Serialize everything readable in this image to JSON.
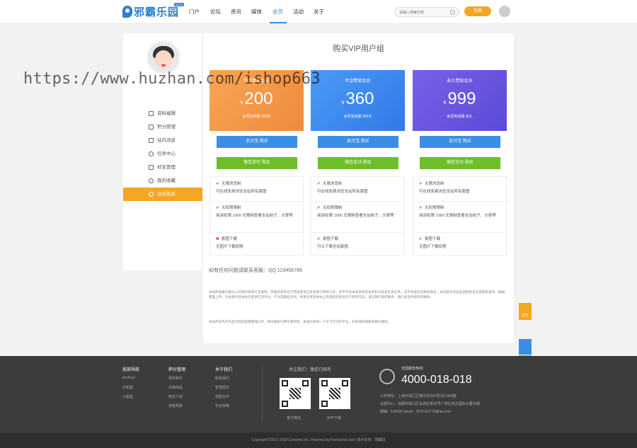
{
  "header": {
    "logo_text": "邪霸乐园",
    "logo_badge": "BETA",
    "nav": [
      "门户",
      "论坛",
      "资讯",
      "媒体",
      "会员",
      "活动",
      "关于"
    ],
    "search_placeholder": "请输入搜索内容",
    "post_button": "投稿"
  },
  "sidebar": {
    "items": [
      {
        "label": "资料编辑",
        "icon": "edit-icon"
      },
      {
        "label": "积分管理",
        "icon": "card-icon"
      },
      {
        "label": "站内消息",
        "icon": "mail-icon"
      },
      {
        "label": "任务中心",
        "icon": "info-icon"
      },
      {
        "label": "好友管理",
        "icon": "friends-icon"
      },
      {
        "label": "我的收藏",
        "icon": "gear-icon"
      },
      {
        "label": "会员购买",
        "icon": "heart-icon"
      }
    ],
    "active_index": 6
  },
  "main": {
    "title": "购买VIP用户组",
    "plans": [
      {
        "name": "包月赞助会员",
        "currency": "¥",
        "price": "200",
        "duration": "会员有效期 185天",
        "color": "#f5a04a"
      },
      {
        "name": "年会赞助会员",
        "currency": "¥",
        "price": "360",
        "duration": "会员有效期 365天",
        "color": "#3f8ef0"
      },
      {
        "name": "永久赞助会员",
        "currency": "¥",
        "price": "999",
        "duration": "会员有效期 永久",
        "color": "#6c57e0"
      }
    ],
    "alipay_button": "支付宝 购买",
    "wechat_button": "微信支付 购买",
    "features": [
      [
        {
          "title": "无限浏览制",
          "desc": "可在线免费浏览全站所有套图",
          "ok": true
        },
        {
          "title": "无权限限制",
          "desc": "阅读权限 1000 无限制查看全站帖子、文章等",
          "ok": true
        },
        {
          "title": "套图下载",
          "desc": "无图片下载权限",
          "ok": false
        }
      ],
      [
        {
          "title": "无限浏览制",
          "desc": "可在线免费浏览全站所有套图",
          "ok": true
        },
        {
          "title": "无权限限制",
          "desc": "阅读权限 1000 无限制查看全站帖子、文章等",
          "ok": true
        },
        {
          "title": "套图下载",
          "desc": "可以下载全站套图",
          "ok": true
        }
      ],
      [
        {
          "title": "无限浏览制",
          "desc": "可在线免费浏览全站所有套图",
          "ok": true
        },
        {
          "title": "无权限限制",
          "desc": "阅读权限 1000 无限制查看全站帖子、文章等",
          "ok": true
        },
        {
          "title": "套图下载",
          "desc": "无图片下载权限",
          "ok": true
        }
      ]
    ],
    "contact": "如有任何问题请联系客服：QQ 123456789",
    "note1": "本站所收集的部分公开资料来源于互联网，转载的目的在于传递更多信息及用于网络分享，并不代表本站赞同其观点和对其真实性负责，也不构成任何其他建议。本站部分作品是由网友自主投稿和发布、编辑整理上传，对此类作品本站仅提供交流平台，不为其版权负责。如果您发现本站上有侵犯您的知识产权的作品，请与我们取得联系，我们会及时修改或删除。",
    "note2": "本站所发布的作品为网友投稿整理分享，相关版权归原作者所有，本站仅提供一个学习交流的平台，如有侵权请联系我们删除。"
  },
  "floating": {
    "top_label": "关灯"
  },
  "footer": {
    "cols": [
      {
        "title": "底部导航",
        "links": [
          "Archiver",
          "手机版",
          "小黑屋"
        ]
      },
      {
        "title": "积分管理",
        "links": [
          "我的积分",
          "兑换商品",
          "积分介绍",
          "查看明单"
        ]
      },
      {
        "title": "关于我们",
        "links": [
          "联系我们",
          "管理团队",
          "加盟合作",
          "安全保障"
        ]
      }
    ],
    "follow_title": "关注我们：微信订阅号",
    "qr_labels": [
      "官方微信",
      "APP下载"
    ],
    "hotline_label": "全国服务热线：",
    "hotline": "4000-018-018",
    "address1": "公司地址：上海市徐汇区漕河泾655号E区1068座",
    "address2": "运营中心：成都市锦江区东城正街42号广电仕双云国际大厦25楼",
    "contact_line": "邮编：610066 Email：2575163778@qq.com",
    "copyright": "Copyright  ©2017-2018  Comsenz Inc.  Powered by©xiebaclub.com!  技术支持：邪霸园"
  },
  "watermark": "https://www.huzhan.com/ishop663"
}
